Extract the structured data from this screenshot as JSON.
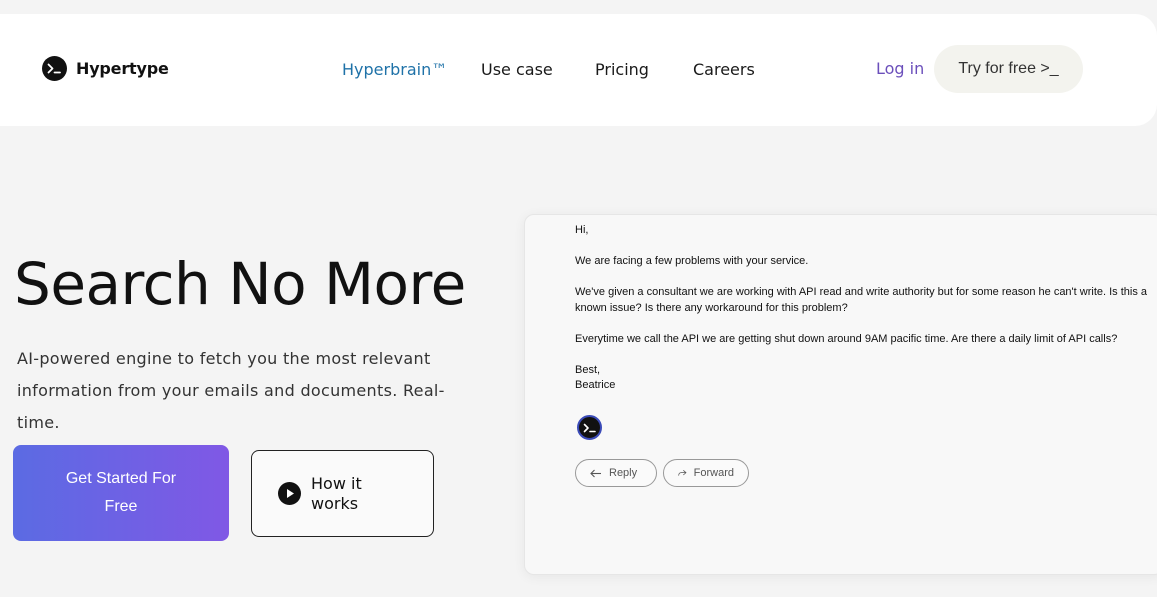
{
  "brand": {
    "name": "Hypertype",
    "logo_icon": "terminal-prompt-icon"
  },
  "nav": {
    "links": [
      {
        "label": "Hyperbrain™",
        "active": true
      },
      {
        "label": "Use case",
        "active": false
      },
      {
        "label": "Pricing",
        "active": false
      },
      {
        "label": "Careers",
        "active": false
      }
    ],
    "login": "Log in",
    "try_free": "Try for free >_"
  },
  "hero": {
    "title": "Search No More",
    "subtitle": "AI-powered engine to fetch you the most relevant information from your emails and documents. Real-time.",
    "cta_primary": "Get Started For Free",
    "cta_secondary": "How it works",
    "cta_secondary_icon": "play-icon"
  },
  "email": {
    "greeting": "Hi,",
    "paragraphs": [
      "We are facing a few problems with your service.",
      "We've given a consultant we are working with API read and write authority but for some reason he can't write. Is this a known issue? Is there any workaround for this problem?",
      "Everytime we call the API we are getting shut down around 9AM pacific time. Are there a daily limit of API calls?"
    ],
    "signoff": "Best,",
    "signature": "Beatrice",
    "reply_label": "Reply",
    "forward_label": "Forward"
  },
  "colors": {
    "accent_link": "#1f72a8",
    "login": "#6b4fbb",
    "cta_gradient_start": "#5b6be3",
    "cta_gradient_end": "#8058e5"
  }
}
